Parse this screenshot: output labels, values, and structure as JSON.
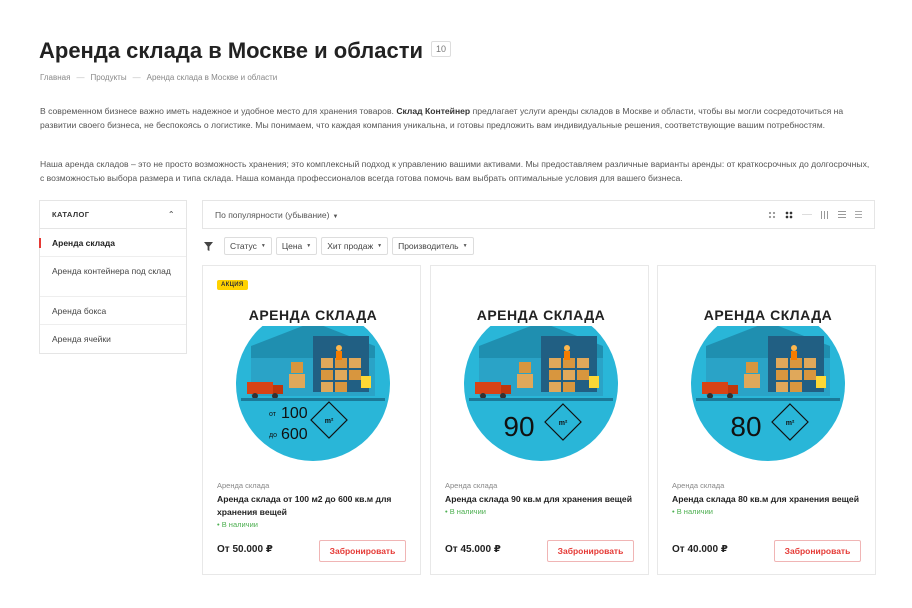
{
  "header": {
    "title": "Аренда склада в Москве и области",
    "count": "10"
  },
  "breadcrumb": [
    {
      "label": "Главная"
    },
    {
      "label": "Продукты"
    },
    {
      "label": "Аренда склада в Москве и области"
    }
  ],
  "description": {
    "p1_before": "В современном бизнесе важно иметь надежное и удобное место для хранения товаров. ",
    "p1_bold": "Склад Контейнер",
    "p1_after": " предлагает услуги аренды складов в Москве и области, чтобы вы могли сосредоточиться на развитии своего бизнеса, не беспокоясь о логистике. Мы понимаем, что каждая компания уникальна, и готовы предложить вам индивидуальные решения, соответствующие вашим потребностям.",
    "p2": "Наша аренда складов – это не просто возможность хранения; это комплексный подход к управлению вашими активами. Мы предоставляем различные варианты аренды: от краткосрочных до долгосрочных, с возможностью выбора размера и типа склада. Наша команда профессионалов всегда готова помочь вам выбрать оптимальные условия для вашего бизнеса."
  },
  "sidebar": {
    "title": "КАТАЛОГ",
    "items": [
      {
        "label": "Аренда склада"
      },
      {
        "label": "Аренда контейнера под склад"
      },
      {
        "label": "Аренда бокса"
      },
      {
        "label": "Аренда ячейки"
      }
    ]
  },
  "sort": {
    "label": "По популярности (убывание)"
  },
  "filters": [
    {
      "label": "Статус"
    },
    {
      "label": "Цена"
    },
    {
      "label": "Хит продаж"
    },
    {
      "label": "Производитель"
    }
  ],
  "products": [
    {
      "badge": "АКЦИЯ",
      "banner": "АРЕНДА СКЛАДА",
      "area_from_prefix": "от",
      "area_from": "100",
      "area_to_prefix": "до",
      "area_to": "600",
      "area_unit": "m²",
      "category": "Аренда склада",
      "name": "Аренда склада от 100 м2 до 600 кв.м для хранения вещей",
      "stock": "В наличии",
      "price": "От 50.000 ₽",
      "button": "Забронировать"
    },
    {
      "banner": "АРЕНДА СКЛАДА",
      "area": "90",
      "area_unit": "m²",
      "category": "Аренда склада",
      "name": "Аренда склада 90 кв.м для хранения вещей",
      "stock": "В наличии",
      "price": "От 45.000 ₽",
      "button": "Забронировать"
    },
    {
      "banner": "АРЕНДА СКЛАДА",
      "area": "80",
      "area_unit": "m²",
      "category": "Аренда склада",
      "name": "Аренда склада 80 кв.м для хранения вещей",
      "stock": "В наличии",
      "price": "От 40.000 ₽",
      "button": "Забронировать"
    }
  ],
  "colors": {
    "accent": "#e53935",
    "badge": "#ffd200",
    "stock": "#4caf50",
    "image_circle": "#29b6d8"
  }
}
